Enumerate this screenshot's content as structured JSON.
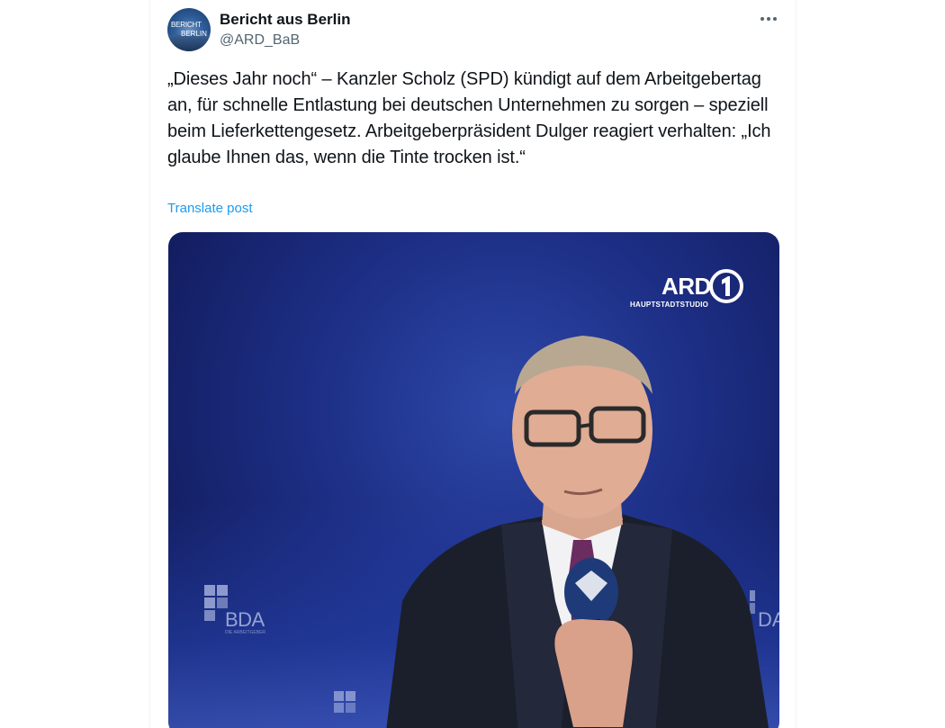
{
  "tweet": {
    "display_name": "Bericht aus Berlin",
    "handle": "@ARD_BaB",
    "avatar_line1": "BERICHT",
    "avatar_line2": "BERLIN",
    "more_icon": "more-horizontal-icon",
    "text": "„Dieses Jahr noch“ – Kanzler Scholz (SPD) kündigt auf dem Arbeitgebertag an, für schnelle Entlastung bei deutschen Unternehmen zu sorgen – speziell beim Lieferkettengesetz. Arbeitgeberpräsident Dulger reagiert verhalten: „Ich glaube Ihnen das, wenn die Tinte trocken ist.“",
    "translate_label": "Translate post"
  },
  "media": {
    "logo_text": "ARD",
    "logo_sub": "HAUPTSTADTSTUDIO",
    "backdrop_text": "BDA",
    "backdrop_sub": "DIE ARBEITGEBER",
    "backdrop_right_text": "DA"
  },
  "colors": {
    "text": "#0f1419",
    "secondary": "#536471",
    "link": "#1d9bf0",
    "stage_blue": "#1d2f86"
  }
}
